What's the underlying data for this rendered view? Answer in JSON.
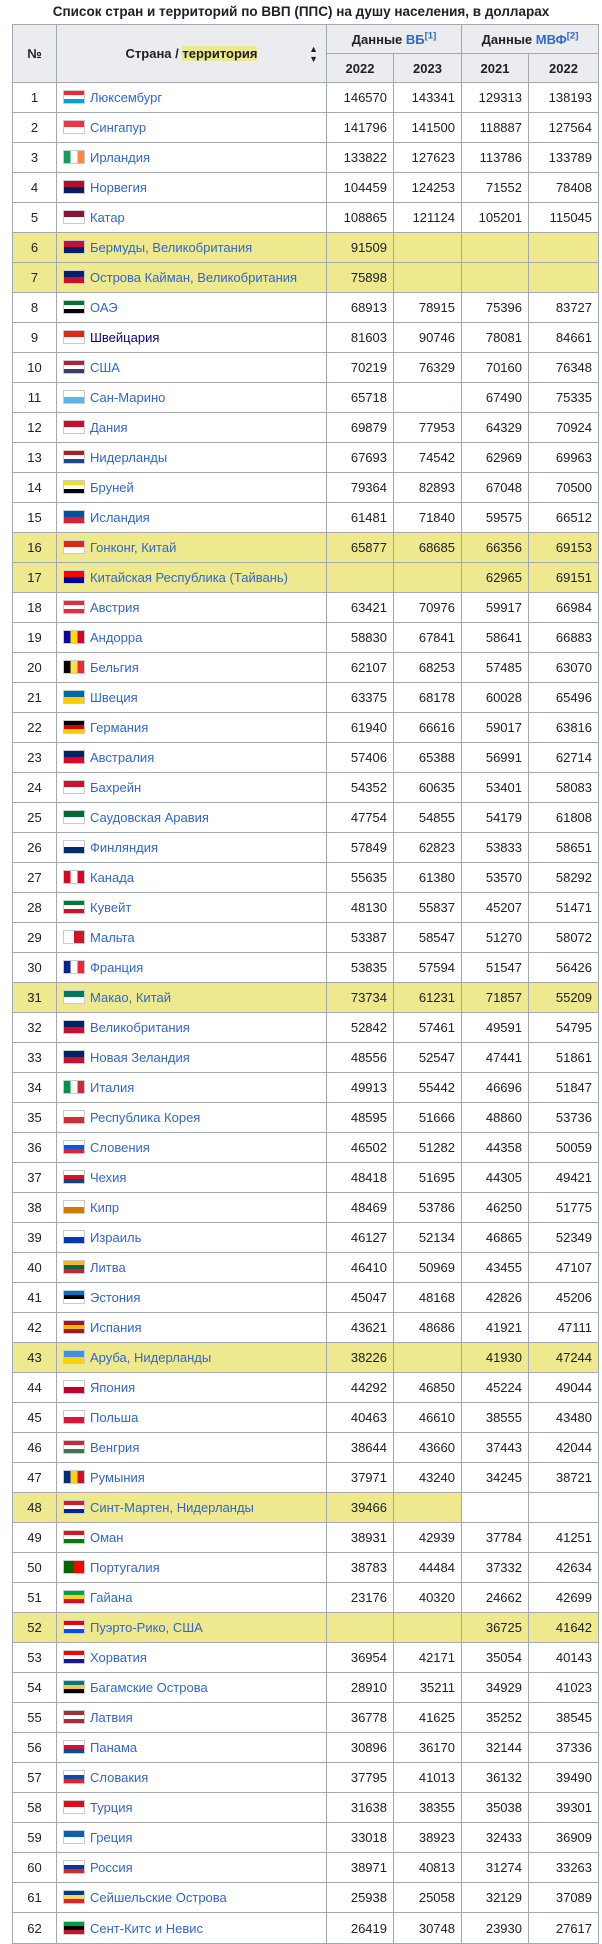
{
  "caption": "Список стран и территорий по ВВП (ППС) на душу населения, в долларах",
  "header": {
    "rank": "№",
    "country_prefix": "Страна / ",
    "country_highlight": "территория",
    "wb_prefix": "Данные ",
    "wb_link": "ВБ",
    "wb_ref": "[1]",
    "imf_prefix": "Данные ",
    "imf_link": "МВФ",
    "imf_ref": "[2]",
    "years": [
      "2022",
      "2023",
      "2021",
      "2022"
    ]
  },
  "rows": [
    {
      "rank": "1",
      "name": "Люксембург",
      "flag": [
        "#ed2939",
        "#ffffff",
        "#00a1de"
      ],
      "v": [
        "146570",
        "143341",
        "129313",
        "138193"
      ]
    },
    {
      "rank": "2",
      "name": "Сингапур",
      "flag": [
        "#ef3340",
        "#ffffff"
      ],
      "v": [
        "141796",
        "141500",
        "118887",
        "127564"
      ]
    },
    {
      "rank": "3",
      "name": "Ирландия",
      "flag": [
        "#169b62",
        "#ffffff",
        "#ff883e"
      ],
      "flagv": true,
      "v": [
        "133822",
        "127623",
        "113786",
        "133789"
      ]
    },
    {
      "rank": "4",
      "name": "Норвегия",
      "flag": [
        "#ba0c2f",
        "#00205b"
      ],
      "v": [
        "104459",
        "124253",
        "71552",
        "78408"
      ]
    },
    {
      "rank": "5",
      "name": "Катар",
      "flag": [
        "#8a1538",
        "#ffffff"
      ],
      "v": [
        "108865",
        "121124",
        "105201",
        "115045"
      ]
    },
    {
      "rank": "6",
      "name": "Бермуды, Великобритания",
      "flag": [
        "#c8102e",
        "#012169"
      ],
      "hl": true,
      "v": [
        "91509",
        "",
        "",
        ""
      ]
    },
    {
      "rank": "7",
      "name": "Острова Кайман, Великобритания",
      "flag": [
        "#012169",
        "#c8102e"
      ],
      "hl": true,
      "v": [
        "75898",
        "",
        "",
        ""
      ]
    },
    {
      "rank": "8",
      "name": "ОАЭ",
      "flag": [
        "#00732f",
        "#ffffff",
        "#000000"
      ],
      "v": [
        "68913",
        "78915",
        "75396",
        "83727"
      ]
    },
    {
      "rank": "9",
      "name": "Швейцария",
      "flag": [
        "#da291c",
        "#ffffff"
      ],
      "visited": true,
      "v": [
        "81603",
        "90746",
        "78081",
        "84661"
      ]
    },
    {
      "rank": "10",
      "name": "США",
      "flag": [
        "#b22234",
        "#ffffff",
        "#3c3b6e"
      ],
      "v": [
        "70219",
        "76329",
        "70160",
        "76348"
      ]
    },
    {
      "rank": "11",
      "name": "Сан-Марино",
      "flag": [
        "#ffffff",
        "#5eb6e4"
      ],
      "v": [
        "65718",
        "",
        "67490",
        "75335"
      ]
    },
    {
      "rank": "12",
      "name": "Дания",
      "flag": [
        "#c8102e",
        "#ffffff"
      ],
      "v": [
        "69879",
        "77953",
        "64329",
        "70924"
      ]
    },
    {
      "rank": "13",
      "name": "Нидерланды",
      "flag": [
        "#ae1c28",
        "#ffffff",
        "#21468b"
      ],
      "v": [
        "67693",
        "74542",
        "62969",
        "69963"
      ]
    },
    {
      "rank": "14",
      "name": "Бруней",
      "flag": [
        "#f7e017",
        "#ffffff",
        "#000000"
      ],
      "v": [
        "79364",
        "82893",
        "67048",
        "70500"
      ]
    },
    {
      "rank": "15",
      "name": "Исландия",
      "flag": [
        "#02529c",
        "#dc1e35"
      ],
      "v": [
        "61481",
        "71840",
        "59575",
        "66512"
      ]
    },
    {
      "rank": "16",
      "name": "Гонконг, Китай",
      "flag": [
        "#de2910",
        "#ffffff"
      ],
      "hl": true,
      "v": [
        "65877",
        "68685",
        "66356",
        "69153"
      ]
    },
    {
      "rank": "17",
      "name": "Китайская Республика (Тайвань)",
      "flag": [
        "#fe0000",
        "#000095"
      ],
      "hl": true,
      "v": [
        "",
        "",
        "62965",
        "69151"
      ]
    },
    {
      "rank": "18",
      "name": "Австрия",
      "flag": [
        "#ed2939",
        "#ffffff",
        "#ed2939"
      ],
      "v": [
        "63421",
        "70976",
        "59917",
        "66984"
      ]
    },
    {
      "rank": "19",
      "name": "Андорра",
      "flag": [
        "#10069f",
        "#fedf00",
        "#d50032"
      ],
      "flagv": true,
      "v": [
        "58830",
        "67841",
        "58641",
        "66883"
      ]
    },
    {
      "rank": "20",
      "name": "Бельгия",
      "flag": [
        "#000000",
        "#fae042",
        "#ed2939"
      ],
      "flagv": true,
      "v": [
        "62107",
        "68253",
        "57485",
        "63070"
      ]
    },
    {
      "rank": "21",
      "name": "Швеция",
      "flag": [
        "#006aa7",
        "#fecc00"
      ],
      "v": [
        "63375",
        "68178",
        "60028",
        "65496"
      ]
    },
    {
      "rank": "22",
      "name": "Германия",
      "flag": [
        "#000000",
        "#dd0000",
        "#ffce00"
      ],
      "v": [
        "61940",
        "66616",
        "59017",
        "63816"
      ]
    },
    {
      "rank": "23",
      "name": "Австралия",
      "flag": [
        "#012169",
        "#e4002b"
      ],
      "v": [
        "57406",
        "65388",
        "56991",
        "62714"
      ]
    },
    {
      "rank": "24",
      "name": "Бахрейн",
      "flag": [
        "#ce1126",
        "#ffffff"
      ],
      "v": [
        "54352",
        "60635",
        "53401",
        "58083"
      ]
    },
    {
      "rank": "25",
      "name": "Саудовская Аравия",
      "flag": [
        "#006c35",
        "#ffffff"
      ],
      "v": [
        "47754",
        "54855",
        "54179",
        "61808"
      ]
    },
    {
      "rank": "26",
      "name": "Финляндия",
      "flag": [
        "#ffffff",
        "#002f6c"
      ],
      "v": [
        "57849",
        "62823",
        "53833",
        "58651"
      ]
    },
    {
      "rank": "27",
      "name": "Канада",
      "flag": [
        "#d80621",
        "#ffffff",
        "#d80621"
      ],
      "flagv": true,
      "v": [
        "55635",
        "61380",
        "53570",
        "58292"
      ]
    },
    {
      "rank": "28",
      "name": "Кувейт",
      "flag": [
        "#007a3d",
        "#ffffff",
        "#ce1126"
      ],
      "v": [
        "48130",
        "55837",
        "45207",
        "51471"
      ]
    },
    {
      "rank": "29",
      "name": "Мальта",
      "flag": [
        "#ffffff",
        "#cf142b"
      ],
      "flagv": true,
      "v": [
        "53387",
        "58547",
        "51270",
        "58072"
      ]
    },
    {
      "rank": "30",
      "name": "Франция",
      "flag": [
        "#002395",
        "#ffffff",
        "#ed2939"
      ],
      "flagv": true,
      "v": [
        "53835",
        "57594",
        "51547",
        "56426"
      ]
    },
    {
      "rank": "31",
      "name": "Макао, Китай",
      "flag": [
        "#00785e",
        "#ffffff"
      ],
      "hl": true,
      "v": [
        "73734",
        "61231",
        "71857",
        "55209"
      ]
    },
    {
      "rank": "32",
      "name": "Великобритания",
      "flag": [
        "#012169",
        "#c8102e"
      ],
      "v": [
        "52842",
        "57461",
        "49591",
        "54795"
      ]
    },
    {
      "rank": "33",
      "name": "Новая Зеландия",
      "flag": [
        "#012169",
        "#c8102e"
      ],
      "v": [
        "48556",
        "52547",
        "47441",
        "51861"
      ]
    },
    {
      "rank": "34",
      "name": "Италия",
      "flag": [
        "#009246",
        "#ffffff",
        "#ce2b37"
      ],
      "flagv": true,
      "v": [
        "49913",
        "55442",
        "46696",
        "51847"
      ]
    },
    {
      "rank": "35",
      "name": "Республика Корея",
      "flag": [
        "#ffffff",
        "#cd2e3a"
      ],
      "v": [
        "48595",
        "51666",
        "48860",
        "53736"
      ]
    },
    {
      "rank": "36",
      "name": "Словения",
      "flag": [
        "#ffffff",
        "#005ce5",
        "#ed1c24"
      ],
      "v": [
        "46502",
        "51282",
        "44358",
        "50059"
      ]
    },
    {
      "rank": "37",
      "name": "Чехия",
      "flag": [
        "#ffffff",
        "#d7141a",
        "#11457e"
      ],
      "v": [
        "48418",
        "51695",
        "44305",
        "49421"
      ]
    },
    {
      "rank": "38",
      "name": "Кипр",
      "flag": [
        "#ffffff",
        "#d57800"
      ],
      "v": [
        "48469",
        "53786",
        "46250",
        "51775"
      ]
    },
    {
      "rank": "39",
      "name": "Израиль",
      "flag": [
        "#ffffff",
        "#0038b8"
      ],
      "v": [
        "46127",
        "52134",
        "46865",
        "52349"
      ]
    },
    {
      "rank": "40",
      "name": "Литва",
      "flag": [
        "#fdb913",
        "#006a44",
        "#c1272d"
      ],
      "v": [
        "46410",
        "50969",
        "43455",
        "47107"
      ]
    },
    {
      "rank": "41",
      "name": "Эстония",
      "flag": [
        "#0072ce",
        "#000000",
        "#ffffff"
      ],
      "v": [
        "45047",
        "48168",
        "42826",
        "45206"
      ]
    },
    {
      "rank": "42",
      "name": "Испания",
      "flag": [
        "#aa151b",
        "#f1bf00",
        "#aa151b"
      ],
      "v": [
        "43621",
        "48686",
        "41921",
        "47111"
      ]
    },
    {
      "rank": "43",
      "name": "Аруба, Нидерланды",
      "flag": [
        "#418fde",
        "#ffd100"
      ],
      "hl": true,
      "v": [
        "38226",
        "",
        "41930",
        "47244"
      ]
    },
    {
      "rank": "44",
      "name": "Япония",
      "flag": [
        "#ffffff",
        "#bc002d"
      ],
      "v": [
        "44292",
        "46850",
        "45224",
        "49044"
      ]
    },
    {
      "rank": "45",
      "name": "Польша",
      "flag": [
        "#ffffff",
        "#dc143c"
      ],
      "v": [
        "40463",
        "46610",
        "38555",
        "43480"
      ]
    },
    {
      "rank": "46",
      "name": "Венгрия",
      "flag": [
        "#ce2939",
        "#ffffff",
        "#477050"
      ],
      "v": [
        "38644",
        "43660",
        "37443",
        "42044"
      ]
    },
    {
      "rank": "47",
      "name": "Румыния",
      "flag": [
        "#002b7f",
        "#fcd116",
        "#ce1126"
      ],
      "flagv": true,
      "v": [
        "37971",
        "43240",
        "34245",
        "38721"
      ]
    },
    {
      "rank": "48",
      "name": "Синт-Мартен, Нидерланды",
      "flag": [
        "#dc171d",
        "#ffffff",
        "#012a87"
      ],
      "hl": true,
      "partial": true,
      "v": [
        "39466",
        "",
        "",
        ""
      ]
    },
    {
      "rank": "49",
      "name": "Оман",
      "flag": [
        "#db161b",
        "#ffffff",
        "#008000"
      ],
      "v": [
        "38931",
        "42939",
        "37784",
        "41251"
      ]
    },
    {
      "rank": "50",
      "name": "Португалия",
      "flag": [
        "#006600",
        "#ff0000"
      ],
      "flagv": true,
      "v": [
        "38783",
        "44484",
        "37332",
        "42634"
      ]
    },
    {
      "rank": "51",
      "name": "Гайана",
      "flag": [
        "#009e49",
        "#fcd116",
        "#ce1126"
      ],
      "v": [
        "23176",
        "40320",
        "24662",
        "42699"
      ]
    },
    {
      "rank": "52",
      "name": "Пуэрто-Рико, США",
      "flag": [
        "#ed0000",
        "#ffffff",
        "#0050f0"
      ],
      "hl": true,
      "v": [
        "",
        "",
        "36725",
        "41642"
      ]
    },
    {
      "rank": "53",
      "name": "Хорватия",
      "flag": [
        "#ff0000",
        "#ffffff",
        "#171796"
      ],
      "v": [
        "36954",
        "42171",
        "35054",
        "40143"
      ]
    },
    {
      "rank": "54",
      "name": "Багамские Острова",
      "flag": [
        "#00778b",
        "#ffc72c",
        "#000000"
      ],
      "v": [
        "28910",
        "35211",
        "34929",
        "41023"
      ]
    },
    {
      "rank": "55",
      "name": "Латвия",
      "flag": [
        "#9e3039",
        "#ffffff",
        "#9e3039"
      ],
      "v": [
        "36778",
        "41625",
        "35252",
        "38545"
      ]
    },
    {
      "rank": "56",
      "name": "Панама",
      "flag": [
        "#ffffff",
        "#d21034",
        "#005293"
      ],
      "v": [
        "30896",
        "36170",
        "32144",
        "37336"
      ]
    },
    {
      "rank": "57",
      "name": "Словакия",
      "flag": [
        "#ffffff",
        "#0b4ea2",
        "#ee1c25"
      ],
      "v": [
        "37795",
        "41013",
        "36132",
        "39490"
      ]
    },
    {
      "rank": "58",
      "name": "Турция",
      "flag": [
        "#e30a17",
        "#ffffff"
      ],
      "v": [
        "31638",
        "38355",
        "35038",
        "39301"
      ]
    },
    {
      "rank": "59",
      "name": "Греция",
      "flag": [
        "#0d5eaf",
        "#ffffff"
      ],
      "v": [
        "33018",
        "38923",
        "32433",
        "36909"
      ]
    },
    {
      "rank": "60",
      "name": "Россия",
      "flag": [
        "#ffffff",
        "#0039a6",
        "#d52b1e"
      ],
      "v": [
        "38971",
        "40813",
        "31274",
        "33263"
      ]
    },
    {
      "rank": "61",
      "name": "Сейшельские Острова",
      "flag": [
        "#003f87",
        "#fcd856",
        "#d62828"
      ],
      "v": [
        "25938",
        "25058",
        "32129",
        "37089"
      ]
    },
    {
      "rank": "62",
      "name": "Сент-Китс и Невис",
      "flag": [
        "#009e49",
        "#000000",
        "#ce1126"
      ],
      "v": [
        "26419",
        "30748",
        "23930",
        "27617"
      ]
    }
  ]
}
